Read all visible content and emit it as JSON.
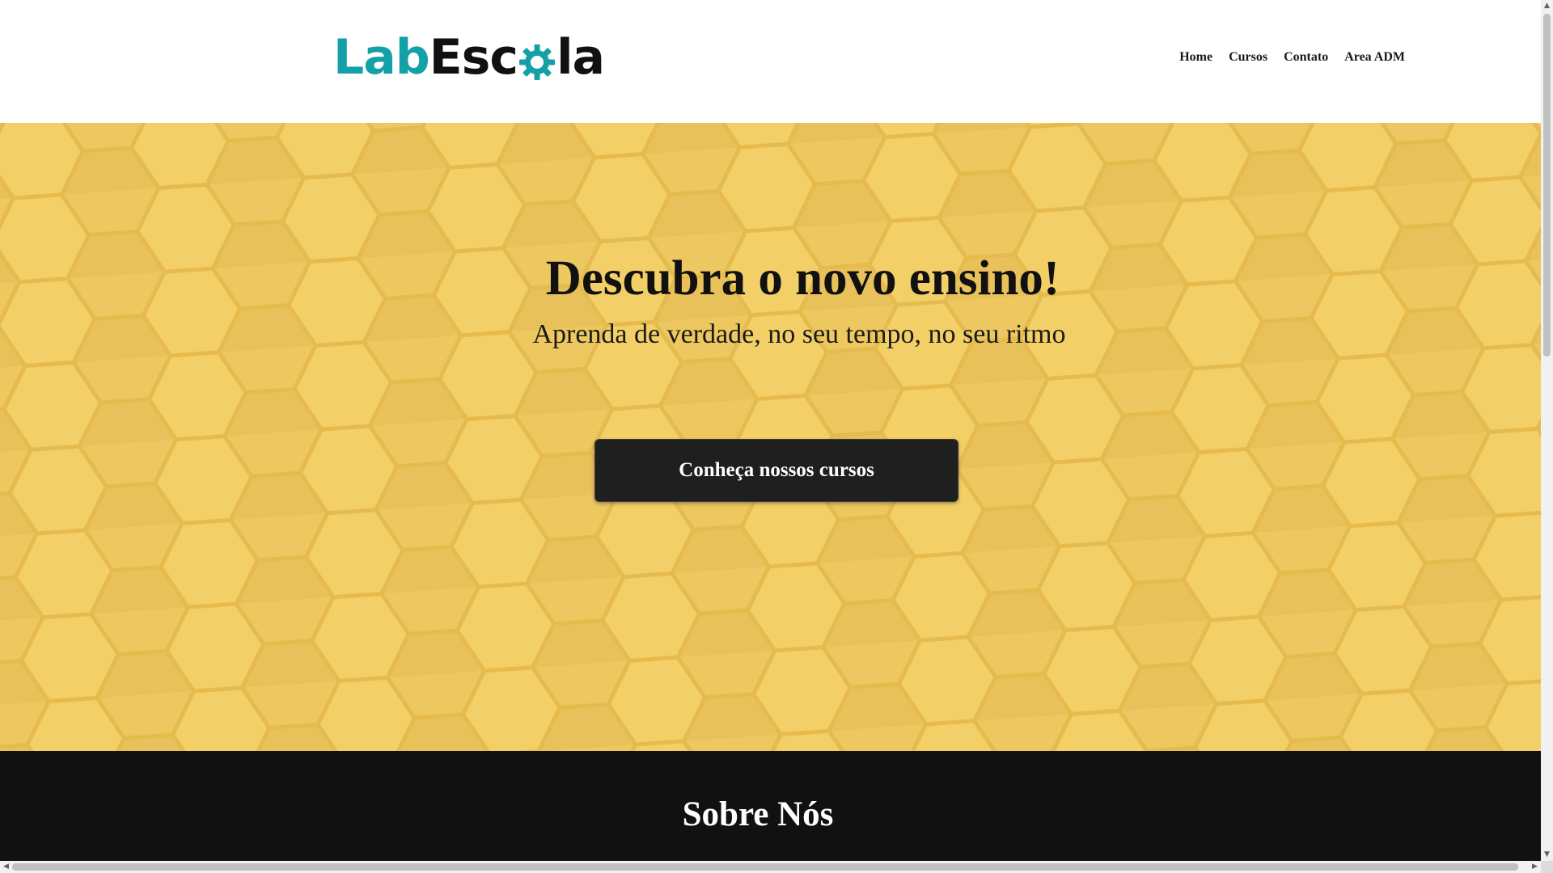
{
  "header": {
    "logo": {
      "part1": "Lab",
      "part2a": "Esc",
      "part2b": "la"
    },
    "nav": [
      {
        "label": "Home"
      },
      {
        "label": "Cursos"
      },
      {
        "label": "Contato"
      },
      {
        "label": "Area ADM"
      }
    ]
  },
  "hero": {
    "title": "Descubra o novo ensino!",
    "subtitle": "Aprenda de verdade, no seu tempo, no seu ritmo",
    "cta_label": "Conheça nossos cursos"
  },
  "floating": {
    "icon": "whatsapp-icon"
  },
  "about": {
    "title": "Sobre Nós"
  },
  "scrollbars": {
    "up": "▲",
    "down": "▼",
    "left": "◀",
    "right": "▶"
  },
  "colors": {
    "brand_teal": "#13a0a6",
    "hero_yellow": "#efc65a",
    "dark": "#111111",
    "whatsapp_green": "#25d366"
  }
}
